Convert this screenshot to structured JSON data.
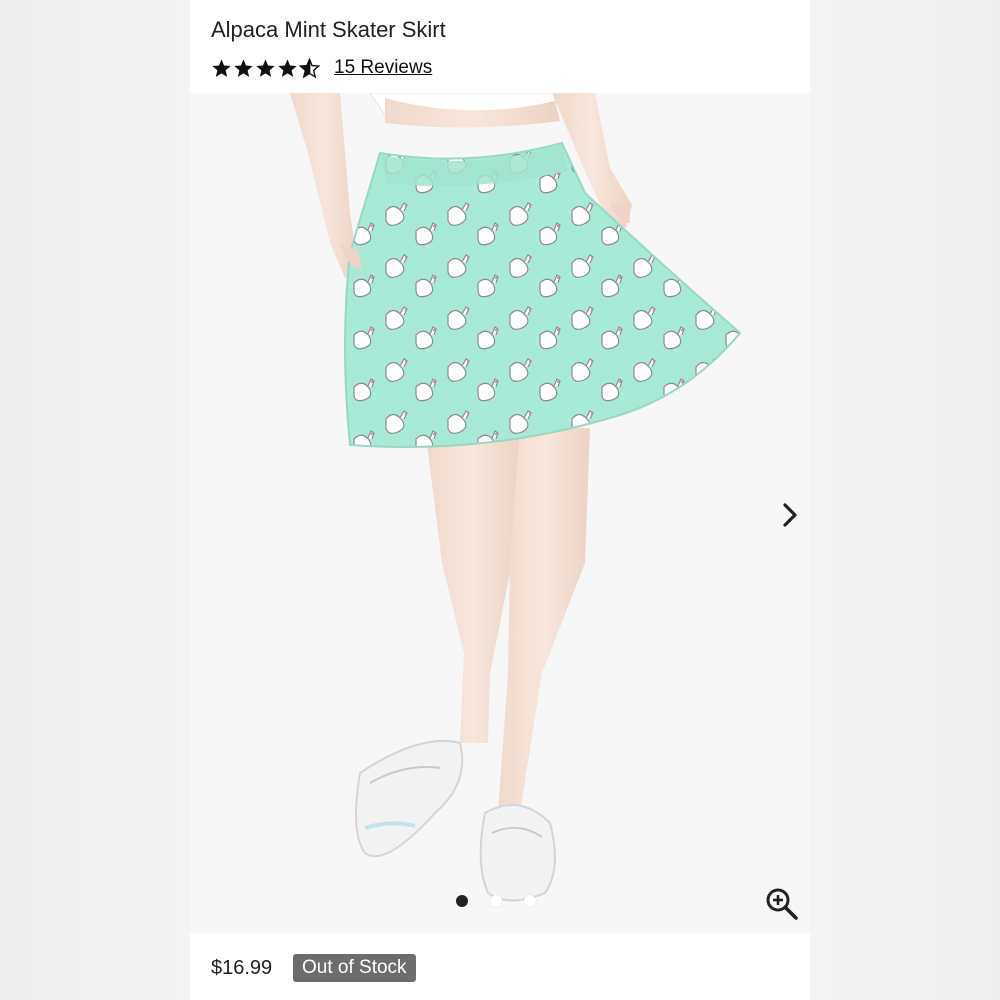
{
  "product": {
    "title": "Alpaca Mint Skater Skirt",
    "rating": {
      "value": 4.5,
      "max": 5
    },
    "reviews_label": "15 Reviews",
    "price": "$16.99",
    "stock_status": "Out of Stock"
  },
  "gallery": {
    "current_index": 1,
    "total": 3,
    "icons": {
      "next": "chevron-right-icon",
      "zoom": "zoom-in-icon"
    }
  },
  "colors": {
    "skirt_mint": "#a8ead6",
    "badge_bg": "#6d6d6d",
    "text": "#222222"
  }
}
